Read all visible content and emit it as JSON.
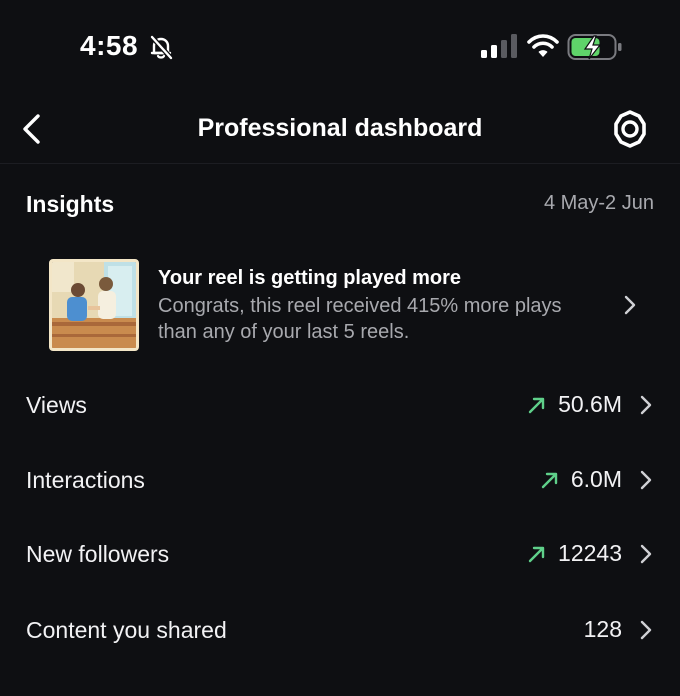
{
  "status_bar": {
    "time": "4:58"
  },
  "header": {
    "title": "Professional dashboard"
  },
  "insights": {
    "title": "Insights",
    "date_range": "4 May-2 Jun"
  },
  "reel_card": {
    "title": "Your reel is getting played more",
    "description": "Congrats, this reel received 415% more plays than any of your last 5 reels."
  },
  "metrics": [
    {
      "label": "Views",
      "value": "50.6M",
      "trend": "up"
    },
    {
      "label": "Interactions",
      "value": "6.0M",
      "trend": "up"
    },
    {
      "label": "New followers",
      "value": "12243",
      "trend": "up"
    },
    {
      "label": "Content you shared",
      "value": "128",
      "trend": "none"
    }
  ],
  "colors": {
    "background": "#0e0f12",
    "trend_up": "#5fd08a",
    "secondary_text": "#a8a9ae",
    "battery_fill": "#5fd46a"
  },
  "icons": {
    "back": "chevron-left-icon",
    "settings": "gear-icon",
    "silent": "bell-slash-icon",
    "trend": "arrow-up-right-icon",
    "row": "chevron-right-icon"
  }
}
